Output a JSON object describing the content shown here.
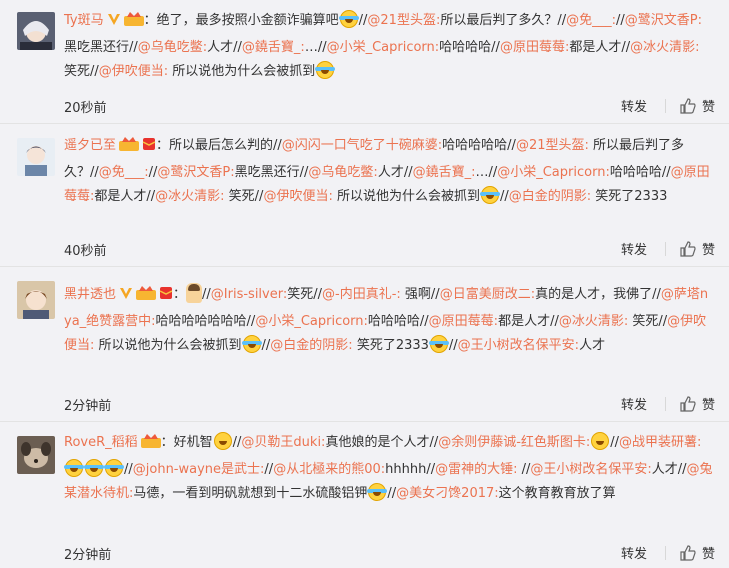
{
  "comments": [
    {
      "username": "Ty斑马",
      "avatar_icon": "anime-girl-avatar",
      "badges": [
        "verified-v-icon",
        "vip-crown-icon"
      ],
      "text_pre": "：绝了，最多按照小金额诈骗算吧",
      "text_post": "//@21型头盔:所以最后判了多久？//@免___://@鹭沢文香P:黑吃黑还行//@乌龟吃鳖:人才//@鐃舌寶_:…//@小栄_Capricorn:哈哈哈哈//@原田莓莓:都是人才//@冰火清影: 笑死//@伊吹便当: 所以说他为什么会被抓到",
      "emoji_mid": "laugh-cry-emoji",
      "time": "20秒前",
      "repost": "转发",
      "like": "赞"
    },
    {
      "username": "遥夕已至",
      "avatar_icon": "anime-boy-avatar",
      "badges": [
        "vip-crown-icon",
        "red-envelope-icon"
      ],
      "text_pre": "：所以最后怎么判的//@闪闪一口气吃了十碗麻婆:哈哈哈哈哈//@21型头盔: 所以最后判了多久？//@免___://@鹭沢文香P:黑吃黑还行//@乌龟吃鳖:人才//@鐃舌寶_:…//@小栄_Capricorn:哈哈哈哈//@原田莓莓:都是人才//@冰火清影: 笑死//@伊吹便当: 所以说他为什么会被抓到",
      "text_post": "//@白金的阴影: 笑死了2333",
      "time": "40秒前",
      "repost": "转发",
      "like": "赞"
    },
    {
      "username": "黑井透也",
      "avatar_icon": "anime-character-avatar",
      "badges": [
        "verified-v-icon",
        "vip-crown-icon",
        "red-envelope-icon"
      ],
      "text_pre": "：",
      "text_post": "//@Iris-silver:笑死//@-内田真礼-: 强啊//@日富美厨改二:真的是人才，我佛了//@萨塔nya_绝赞露营中:哈哈哈哈哈哈哈//@小栄_Capricorn:哈哈哈哈//@原田莓莓:都是人才//@冰火清影: 笑死//@伊吹便当: 所以说他为什么会被抓到",
      "text_post2": "//@白金的阴影: 笑死了2333",
      "text_post3": "//@王小树改名保平安:人才",
      "time": "2分钟前",
      "repost": "转发",
      "like": "赞"
    },
    {
      "username": "RoveR_稻稻",
      "avatar_icon": "dog-avatar",
      "badges": [
        "vip-crown-icon"
      ],
      "text_pre": "：好机智",
      "text_post": "//@贝勒王duki:真他娘的是个人才//@余则伊藤诚-红色斯图卡:",
      "text_post2": "//@战甲装研薯:",
      "text_post3": "//@john-wayne是武士://@从北極来的熊00:hhhhh//@雷神的大锤: //@王小树改名保平安:人才//@兔某潜水待机:马德，一看到明矾就想到十二水硫酸铝钾",
      "text_post4": "//@美女刁馋2017:这个教育教育放了算",
      "time": "2分钟前",
      "repost": "转发",
      "like": "赞"
    }
  ],
  "colors": {
    "accent": "#eb7350",
    "text": "#333333",
    "bg": "#f2f2f5"
  }
}
